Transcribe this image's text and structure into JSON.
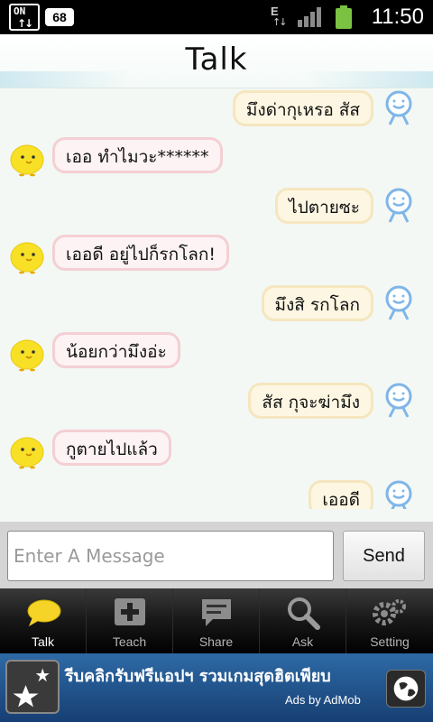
{
  "status_bar": {
    "data_indicator": "ON",
    "notification_count": "68",
    "network_type": "E",
    "time": "11:50"
  },
  "header": {
    "title": "Talk"
  },
  "messages": [
    {
      "from": "user",
      "text": "มึงด่ากุเหรอ สัส"
    },
    {
      "from": "bot",
      "text": "เออ ทำไมวะ******"
    },
    {
      "from": "user",
      "text": "ไปตายซะ"
    },
    {
      "from": "bot",
      "text": "เออดี อยู่ไปก็รกโลก!"
    },
    {
      "from": "user",
      "text": "มึงสิ รกโลก"
    },
    {
      "from": "bot",
      "text": "น้อยกว่ามึงอ่ะ"
    },
    {
      "from": "user",
      "text": "สัส กุจะฆ่ามึง"
    },
    {
      "from": "bot",
      "text": "กูตายไปแล้ว"
    },
    {
      "from": "user",
      "text": "เออดี"
    }
  ],
  "composer": {
    "placeholder": "Enter A Message",
    "send_label": "Send"
  },
  "tabs": [
    {
      "label": "Talk",
      "icon": "speech-bubble-icon",
      "active": true
    },
    {
      "label": "Teach",
      "icon": "plus-box-icon"
    },
    {
      "label": "Share",
      "icon": "chat-share-icon"
    },
    {
      "label": "Ask",
      "icon": "magnifier-icon"
    },
    {
      "label": "Setting",
      "icon": "gears-icon"
    }
  ],
  "ad": {
    "text": "รีบคลิกรับฟรีแอปฯ รวมเกมสุดฮิตเพียบ",
    "by": "Ads by AdMob"
  },
  "colors": {
    "user_bubble_bg": "#fdf6e2",
    "user_bubble_border": "#f5e6bf",
    "bot_bubble_bg": "#fdf3f4",
    "bot_bubble_border": "#f4cfd3",
    "bot_avatar": "#f7e026",
    "user_avatar": "#7fb6e8"
  }
}
